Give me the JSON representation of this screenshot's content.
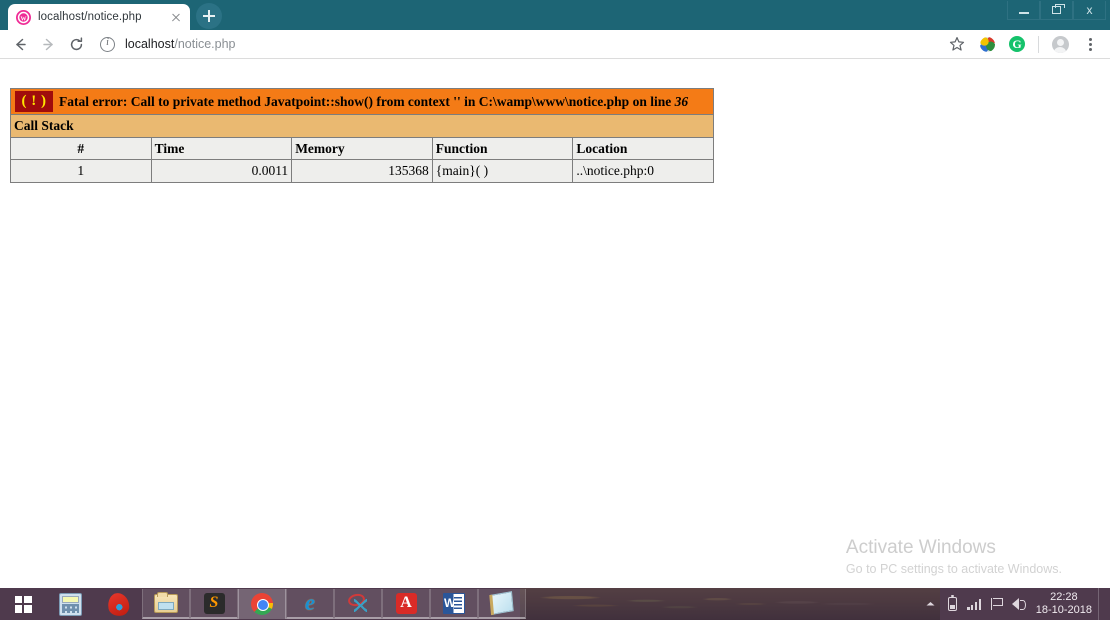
{
  "browser": {
    "tab": {
      "title": "localhost/notice.php",
      "favicon": "wamp-favicon",
      "close_label": "close-tab"
    },
    "new_tab_label": "+",
    "window_controls": {
      "minimize": "minimize",
      "restore": "restore",
      "close": "x"
    },
    "toolbar": {
      "back": "←",
      "forward": "→",
      "reload": "⟳",
      "info_icon": "info-circle-icon",
      "url_host": "localhost",
      "url_path": "/notice.php",
      "url_full": "localhost/notice.php",
      "star": "☆",
      "extension_icon": "globe-extension-icon",
      "grammarly_icon": "G",
      "avatar": "profile-avatar",
      "menu": "three-dot-menu"
    }
  },
  "page": {
    "error": {
      "badge": "( ! )",
      "headline_prefix": "Fatal error: Call to private method Javatpoint::show() from context '' in C:\\wamp\\www\\notice.php on line ",
      "headline_line_number": "36",
      "call_stack_label": "Call Stack",
      "columns": [
        "#",
        "Time",
        "Memory",
        "Function",
        "Location"
      ],
      "rows": [
        {
          "num": "1",
          "time": "0.0011",
          "memory": "135368",
          "function": "{main}( )",
          "location": "..\\notice.php:0"
        }
      ]
    }
  },
  "watermark": {
    "title": "Activate Windows",
    "subtitle": "Go to PC settings to activate Windows."
  },
  "taskbar": {
    "start": "windows-start",
    "apps": [
      {
        "name": "calculator",
        "label": "Calculator"
      },
      {
        "name": "comodo-dragon",
        "label": "Comodo Dragon"
      },
      {
        "name": "file-explorer",
        "label": "File Explorer"
      },
      {
        "name": "sublime-text",
        "label": "Sublime Text"
      },
      {
        "name": "google-chrome",
        "label": "Google Chrome"
      },
      {
        "name": "internet-explorer",
        "label": "Internet Explorer"
      },
      {
        "name": "snipping-tool",
        "label": "Snipping Tool"
      },
      {
        "name": "adobe-acrobat",
        "label": "Adobe Acrobat Reader"
      },
      {
        "name": "microsoft-word",
        "label": "Microsoft Word"
      },
      {
        "name": "notepad",
        "label": "Notepad"
      }
    ],
    "tray": {
      "chevron": "▲",
      "battery": "battery-icon",
      "network": "signal-icon",
      "action_center": "flag-icon",
      "volume": "volume-icon"
    },
    "clock": {
      "time": "22:28",
      "date": "18-10-2018"
    }
  },
  "colors": {
    "titlebar": "#1d6575",
    "error_header": "#f47b16",
    "call_stack": "#eab971",
    "badge": "#a00c0c",
    "badge_text": "#ffe600",
    "table_cell": "#eeeeec",
    "taskbar": "#4f3a4d"
  }
}
